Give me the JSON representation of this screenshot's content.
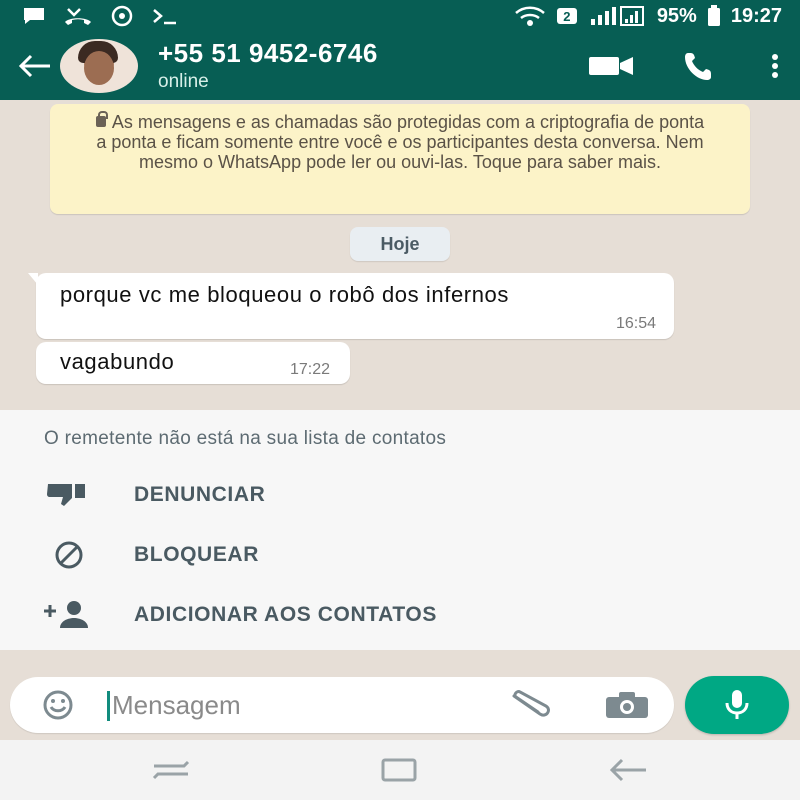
{
  "status_bar": {
    "battery": "95%",
    "time": "19:27",
    "sim_badge": "2",
    "icons": [
      "chat-notification-icon",
      "missed-call-icon",
      "sync-icon",
      "terminal-icon",
      "wifi-icon",
      "signal-icon",
      "battery-icon"
    ]
  },
  "header": {
    "contact_name": "+55 51 9452-6746",
    "contact_status": "online",
    "icons": [
      "back-arrow-icon",
      "video-call-icon",
      "phone-icon",
      "more-vert-icon"
    ]
  },
  "chat": {
    "encryption_notice": "As mensagens e as chamadas são protegidas com a criptografia de ponta a ponta e ficam somente entre você e os participantes desta conversa. Nem mesmo o WhatsApp pode ler ou ouvi-las. Toque para saber mais.",
    "date_label": "Hoje",
    "messages": [
      {
        "text": "porque vc me bloqueou o robô dos infernos",
        "time": "16:54"
      },
      {
        "text": "vagabundo",
        "time": "17:22"
      }
    ]
  },
  "unknown_sender": {
    "title": "O remetente não está na sua lista de contatos",
    "actions": [
      {
        "label": "DENUNCIAR",
        "icon": "thumbs-down-icon"
      },
      {
        "label": "BLOQUEAR",
        "icon": "block-icon"
      },
      {
        "label": "ADICIONAR AOS CONTATOS",
        "icon": "add-contact-icon"
      }
    ]
  },
  "composer": {
    "placeholder": "Mensagem",
    "value": "",
    "icons": [
      "emoji-icon",
      "attach-icon",
      "camera-icon",
      "mic-icon"
    ]
  },
  "colors": {
    "header": "#075e54",
    "accent": "#00a884",
    "notice_bg": "#fcf3c8",
    "chat_bg": "#e6ded6"
  },
  "nav_bar": {
    "icons": [
      "recents-icon",
      "home-icon",
      "back-icon"
    ]
  }
}
